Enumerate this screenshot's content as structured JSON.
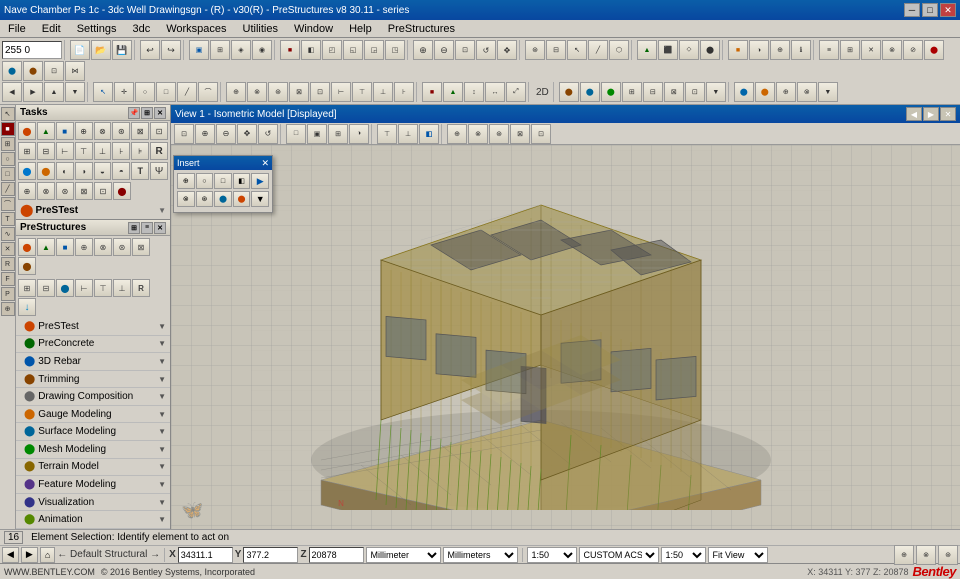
{
  "window": {
    "title": "Nave Chamber Ps 1c - 3dc Well Drawingsgn - (R) - v30(R) - PreStructures v8 30.11 - series"
  },
  "menubar": {
    "items": [
      "File",
      "Edit",
      "Settings",
      "3dc",
      "Workspaces",
      "Utilities",
      "Window",
      "Help",
      "PreStructures"
    ]
  },
  "toolbar": {
    "search_value": "255 0"
  },
  "view": {
    "title": "View 1 - Isometric Model [Displayed]",
    "dialog_title": "Insert"
  },
  "tasks_panel": {
    "title": "Tasks",
    "label": "PreSTest"
  },
  "prestructures_panel": {
    "title": "PreStructures"
  },
  "subpanels": [
    {
      "label": "PreSTest",
      "has_arrow": true
    },
    {
      "label": "PreConcrete",
      "has_arrow": true
    },
    {
      "label": "3D Rebar",
      "has_arrow": true
    },
    {
      "label": "Trimming",
      "has_arrow": true
    },
    {
      "label": "Drawing Composition",
      "has_arrow": true
    },
    {
      "label": "Gauge Modeling",
      "has_arrow": true
    },
    {
      "label": "Surface Modeling",
      "has_arrow": true
    },
    {
      "label": "Mesh Modeling",
      "has_arrow": true
    },
    {
      "label": "Terrain Model",
      "has_arrow": true
    },
    {
      "label": "Feature Modeling",
      "has_arrow": true
    },
    {
      "label": "Visualization",
      "has_arrow": true
    },
    {
      "label": "Animation",
      "has_arrow": true
    }
  ],
  "statusbar": {
    "text": "Element Selection: Identify element to act on",
    "mode": "16"
  },
  "bottombar": {
    "website": "WWW.BENTLEY.COM",
    "copyright": "© 2016 Bentley Systems, Incorporated",
    "bentley_com": "BENTLEY CoM"
  },
  "coords": {
    "x_label": "X",
    "x_value": "34311.1",
    "y_label": "Y",
    "y_value": "377.2",
    "z_label": "Z",
    "z_value": "20878",
    "unit1": "Millimeter",
    "unit2": "Millimeters",
    "scale_label": "1:50",
    "acs_label": "CUSTOM ACS",
    "acs_scale": "1:50",
    "view_label": "Fit View"
  },
  "icons": {
    "minimize": "─",
    "maximize": "□",
    "close": "✕",
    "arrow_down": "▼",
    "arrow_right": "▶",
    "pin": "📌",
    "gear": "⚙",
    "grid": "⊞",
    "zoom_in": "+",
    "zoom_out": "−",
    "rotate": "↺",
    "pan": "✋",
    "fit": "⊡"
  }
}
